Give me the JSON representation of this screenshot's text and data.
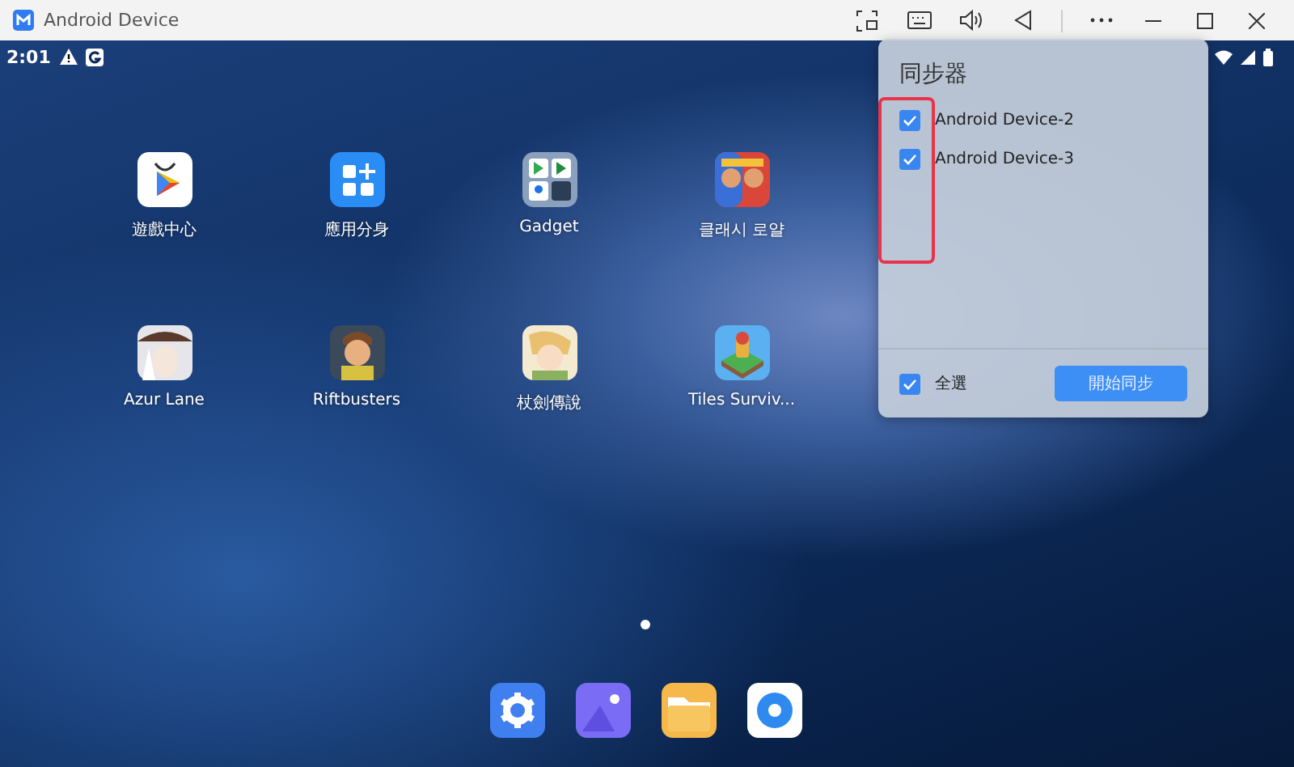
{
  "window": {
    "title": "Android Device"
  },
  "status_bar": {
    "time": "2:01"
  },
  "apps": [
    {
      "label": "遊戲中心"
    },
    {
      "label": "應用分身"
    },
    {
      "label": "Gadget"
    },
    {
      "label": "클래시 로얄"
    },
    {
      "label": "Azur Lane"
    },
    {
      "label": "Riftbusters"
    },
    {
      "label": "杖劍傳說"
    },
    {
      "label": "Tiles Surviv..."
    }
  ],
  "sync_panel": {
    "title": "同步器",
    "devices": [
      {
        "name": "Android Device-2",
        "checked": true
      },
      {
        "name": "Android Device-3",
        "checked": true
      }
    ],
    "select_all": {
      "label": "全選",
      "checked": true
    },
    "start_button": "開始同步"
  }
}
